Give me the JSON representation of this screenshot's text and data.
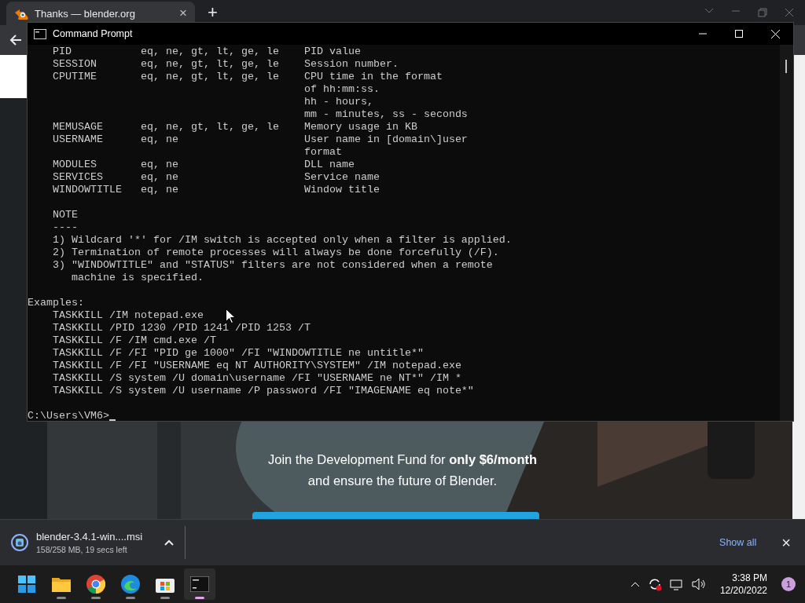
{
  "browser": {
    "tabs": [
      {
        "title": "Thanks — blender.org",
        "close": "×",
        "selected": true
      }
    ],
    "new_tab": "+"
  },
  "console": {
    "title": "Command Prompt",
    "blocks": [
      {
        "lines": [
          "    PID           eq, ne, gt, lt, ge, le    PID value",
          "    SESSION       eq, ne, gt, lt, ge, le    Session number.",
          "    CPUTIME       eq, ne, gt, lt, ge, le    CPU time in the format",
          "                                            of hh:mm:ss.",
          "                                            hh - hours,",
          "                                            mm - minutes, ss - seconds",
          "    MEMUSAGE      eq, ne, gt, lt, ge, le    Memory usage in KB",
          "    USERNAME      eq, ne                    User name in [domain\\]user",
          "                                            format",
          "    MODULES       eq, ne                    DLL name",
          "    SERVICES      eq, ne                    Service name",
          "    WINDOWTITLE   eq, ne                    Window title"
        ]
      },
      {
        "lines": [
          "    NOTE",
          "    ----",
          "    1) Wildcard '*' for /IM switch is accepted only when a filter is applied.",
          "    2) Termination of remote processes will always be done forcefully (/F).",
          "    3) \"WINDOWTITLE\" and \"STATUS\" filters are not considered when a remote",
          "       machine is specified."
        ]
      },
      {
        "lines": [
          "Examples:",
          "    TASKKILL /IM notepad.exe",
          "    TASKKILL /PID 1230 /PID 1241 /PID 1253 /T",
          "    TASKKILL /F /IM cmd.exe /T",
          "    TASKKILL /F /FI \"PID ge 1000\" /FI \"WINDOWTITLE ne untitle*\"",
          "    TASKKILL /F /FI \"USERNAME eq NT AUTHORITY\\SYSTEM\" /IM notepad.exe",
          "    TASKKILL /S system /U domain\\username /FI \"USERNAME ne NT*\" /IM *",
          "    TASKKILL /S system /U username /P password /FI \"IMAGENAME eq note*\""
        ]
      }
    ],
    "prompt": "C:\\Users\\VM6>"
  },
  "page": {
    "kind": "picture",
    "lines": [
      "Join the Development Fund for **only $6/month**",
      "and ensure the future of Blender."
    ]
  },
  "download": {
    "filename": "blender-3.4.1-win....msi",
    "status": "158/258 MB, 19 secs left",
    "show_all": "Show all",
    "close": "×"
  },
  "taskbar": {
    "apps": [
      {
        "kind": "start",
        "selected": false
      },
      {
        "kind": "folder",
        "selected": false
      },
      {
        "kind": "chrome",
        "selected": false
      },
      {
        "kind": "edge",
        "selected": false
      },
      {
        "kind": "store",
        "selected": false
      },
      {
        "kind": "terminal",
        "selected": true
      }
    ],
    "time": "3:38 PM",
    "date": "12/20/2022",
    "notifications": "1"
  }
}
